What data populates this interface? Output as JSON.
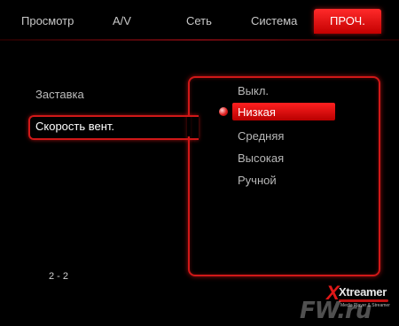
{
  "tabs": [
    {
      "label": "Просмотр"
    },
    {
      "label": "A/V"
    },
    {
      "label": "Сеть"
    },
    {
      "label": "Система"
    },
    {
      "label": "ПРОЧ.",
      "active": true
    }
  ],
  "left_menu": [
    {
      "label": "Заставка"
    },
    {
      "label": "Скорость вент.",
      "selected": true
    }
  ],
  "options": [
    {
      "label": "Выкл."
    },
    {
      "label": "Низкая",
      "selected": true
    },
    {
      "label": "Средняя"
    },
    {
      "label": "Высокая"
    },
    {
      "label": "Ручной"
    }
  ],
  "page_indicator": "2 - 2",
  "logo": {
    "brand": "Xtreamer",
    "tagline": "Media Player & Streamer"
  },
  "watermark": "FW.ru",
  "colors": {
    "accent": "#d01818",
    "background": "#000000",
    "text": "#bdbdbd"
  }
}
